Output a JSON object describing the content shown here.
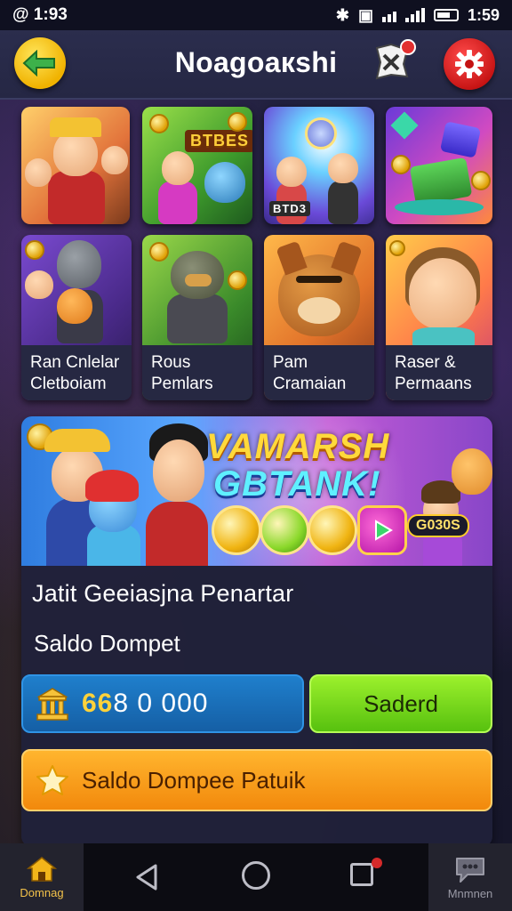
{
  "status_bar": {
    "left_text": "@ 1:93",
    "time": "1:59"
  },
  "header": {
    "title": "Noagoaкshi"
  },
  "games": [
    {
      "label_line1": "",
      "label_line2": ""
    },
    {
      "label_line1": "",
      "label_line2": "",
      "banner": "BTBES"
    },
    {
      "label_line1": "",
      "label_line2": "",
      "banner": "BTD3"
    },
    {
      "label_line1": "",
      "label_line2": ""
    },
    {
      "label_line1": "Ran Cnlelar",
      "label_line2": "Cletboiam"
    },
    {
      "label_line1": "Rous",
      "label_line2": "Pemlars"
    },
    {
      "label_line1": "Pam",
      "label_line2": "Cramaian"
    },
    {
      "label_line1": "Raser &",
      "label_line2": "Permaans"
    }
  ],
  "promo": {
    "title": "VAMARSH",
    "subtitle": "GBTANK!",
    "badge": "G030S"
  },
  "featured": {
    "heading": "Jatit Geeiasjna Penartar",
    "wallet_label": "Saldo Dompet",
    "balance_highlight": "66",
    "balance_rest": "8 0 000",
    "action_label": "Saderd",
    "cta_label": "Saldo Dompee Patuik"
  },
  "nav": {
    "home_label": "Domnag",
    "messages_label": "Mnmnen"
  },
  "colors": {
    "accent_yellow": "#f0b200",
    "settings_red": "#d41a1a",
    "action_green": "#7bd81d",
    "cta_orange": "#f7a21e",
    "balance_blue": "#1a6fb8"
  }
}
